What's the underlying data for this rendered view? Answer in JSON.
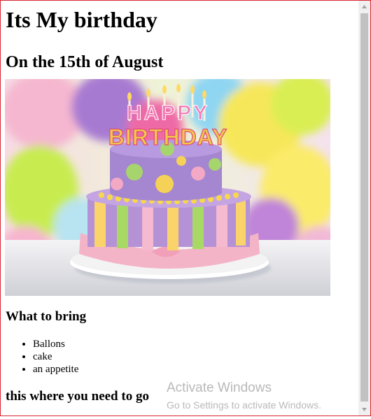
{
  "page": {
    "title": "Its My birthday",
    "date_heading": "On the 15th of August",
    "image": {
      "topper_line1": "HAPPY",
      "topper_line2": "BIRTHDAY"
    },
    "bring_heading": "What to bring",
    "bring_items": [
      "Ballons",
      "cake",
      "an appetite"
    ],
    "go_heading": "this where you need to go"
  },
  "watermark": {
    "title": "Activate Windows",
    "subtitle": "Go to Settings to activate Windows."
  },
  "scrollbar": {
    "up_icon": "triangle-up-icon",
    "down_icon": "triangle-down-icon"
  }
}
